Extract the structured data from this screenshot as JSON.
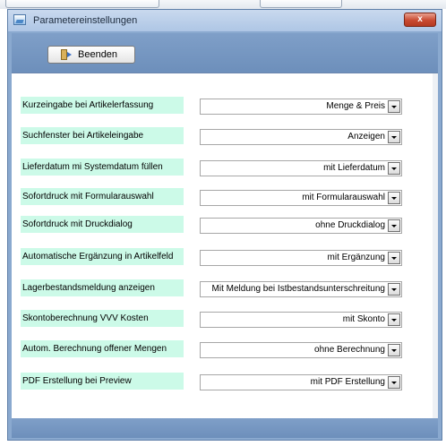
{
  "window": {
    "title": "Parametereinstellungen",
    "close_symbol": "x",
    "close_icon": "close-icon",
    "app_icon": "picture-icon"
  },
  "toolbar": {
    "exit_label": "Beenden",
    "exit_icon": "exit-door-icon"
  },
  "settings": [
    {
      "label": "Kurzeingabe bei Artikelerfassung",
      "value": "Menge & Preis"
    },
    {
      "label": "Suchfenster bei Artikeleingabe",
      "value": "Anzeigen"
    },
    {
      "label": "Lieferdatum mi Systemdatum füllen",
      "value": "mit Lieferdatum"
    },
    {
      "label": "Sofortdruck mit Formularauswahl",
      "value": "mit Formularauswahl"
    },
    {
      "label": "Sofortdruck mit Druckdialog",
      "value": "ohne Druckdialog"
    },
    {
      "label": "Automatische Ergänzung in Artikelfeld",
      "value": "mit  Ergänzung"
    },
    {
      "label": "Lagerbestandsmeldung anzeigen",
      "value": "Mit Meldung bei Istbestandsunterschreitung"
    },
    {
      "label": "Skontoberechnung VVV Kosten",
      "value": "mit Skonto"
    },
    {
      "label": "Autom. Berechnung offener Mengen",
      "value": "ohne Berechnung"
    },
    {
      "label": "PDF Erstellung bei Preview",
      "value": "mit  PDF Erstellung"
    }
  ],
  "colors": {
    "label_background": "#ccfae8",
    "window_frame": "#8aa9cf",
    "close_button": "#c94a31"
  }
}
